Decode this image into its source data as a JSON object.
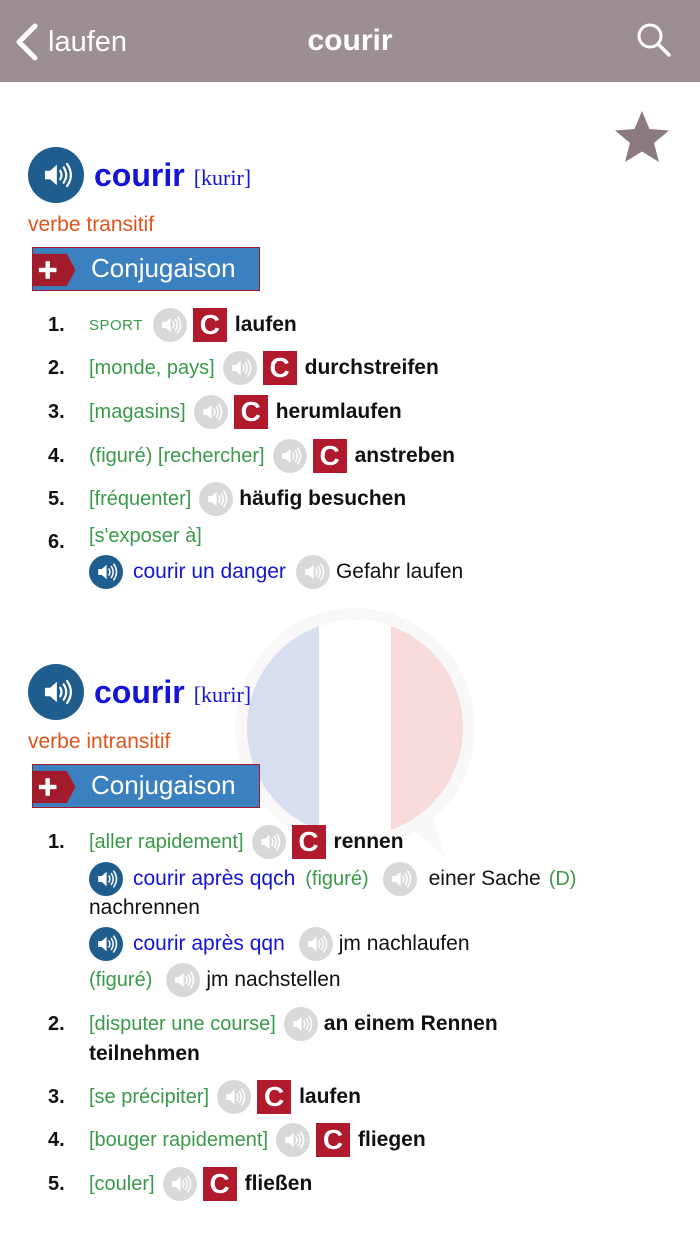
{
  "header": {
    "back_label": "laufen",
    "title": "courir"
  },
  "icons": {
    "back": "chevron-left-icon",
    "search": "search-icon",
    "favorite": "star-icon",
    "audio": "speaker-icon",
    "conjugation": "plus-icon"
  },
  "colors": {
    "header_bg": "#9c8e95",
    "headword": "#1414d8",
    "pos": "#e0541c",
    "context": "#3a9a4a",
    "badge": "#b01a2c",
    "conj_button": "#3b80bf",
    "audio_active": "#1f5d8f"
  },
  "entries": [
    {
      "headword": "courir",
      "pronunciation": "[kurir]",
      "pos": "verbe transitif",
      "conjugation_label": "Conjugaison",
      "senses": [
        {
          "num": "1.",
          "context": "SPORT",
          "badge": "C",
          "translation": "laufen"
        },
        {
          "num": "2.",
          "context": "[monde, pays]",
          "badge": "C",
          "translation": "durchstreifen"
        },
        {
          "num": "3.",
          "context": "[magasins]",
          "badge": "C",
          "translation": "herumlaufen"
        },
        {
          "num": "4.",
          "context": "(figuré) [rechercher]",
          "badge": "C",
          "translation": "anstreben"
        },
        {
          "num": "5.",
          "context": "[fréquenter]",
          "translation": "häufig besuchen"
        },
        {
          "num": "6.",
          "context": "[s'exposer à]",
          "examples": [
            {
              "phrase": "courir un danger",
              "translation": "Gefahr laufen"
            }
          ]
        }
      ]
    },
    {
      "headword": "courir",
      "pronunciation": "[kurir]",
      "pos": "verbe intransitif",
      "conjugation_label": "Conjugaison",
      "senses": [
        {
          "num": "1.",
          "context": "[aller rapidement]",
          "badge": "C",
          "translation": "rennen",
          "examples": [
            {
              "phrase": "courir après qqch",
              "context": "(figuré)",
              "translation_line1": "einer Sache",
              "case": "(D)",
              "translation_line2": "nachrennen"
            },
            {
              "phrase": "courir après qqn",
              "translation": "jm nachlaufen",
              "figurative_context": "(figuré)",
              "figurative_translation": "jm nachstellen"
            }
          ]
        },
        {
          "num": "2.",
          "context": "[disputer une course]",
          "translation_line1": "an einem Rennen",
          "translation_line2": "teilnehmen"
        },
        {
          "num": "3.",
          "context": "[se précipiter]",
          "badge": "C",
          "translation": "laufen"
        },
        {
          "num": "4.",
          "context": "[bouger rapidement]",
          "badge": "C",
          "translation": "fliegen"
        },
        {
          "num": "5.",
          "context": "[couler]",
          "badge": "C",
          "translation": "fließen"
        }
      ]
    }
  ]
}
